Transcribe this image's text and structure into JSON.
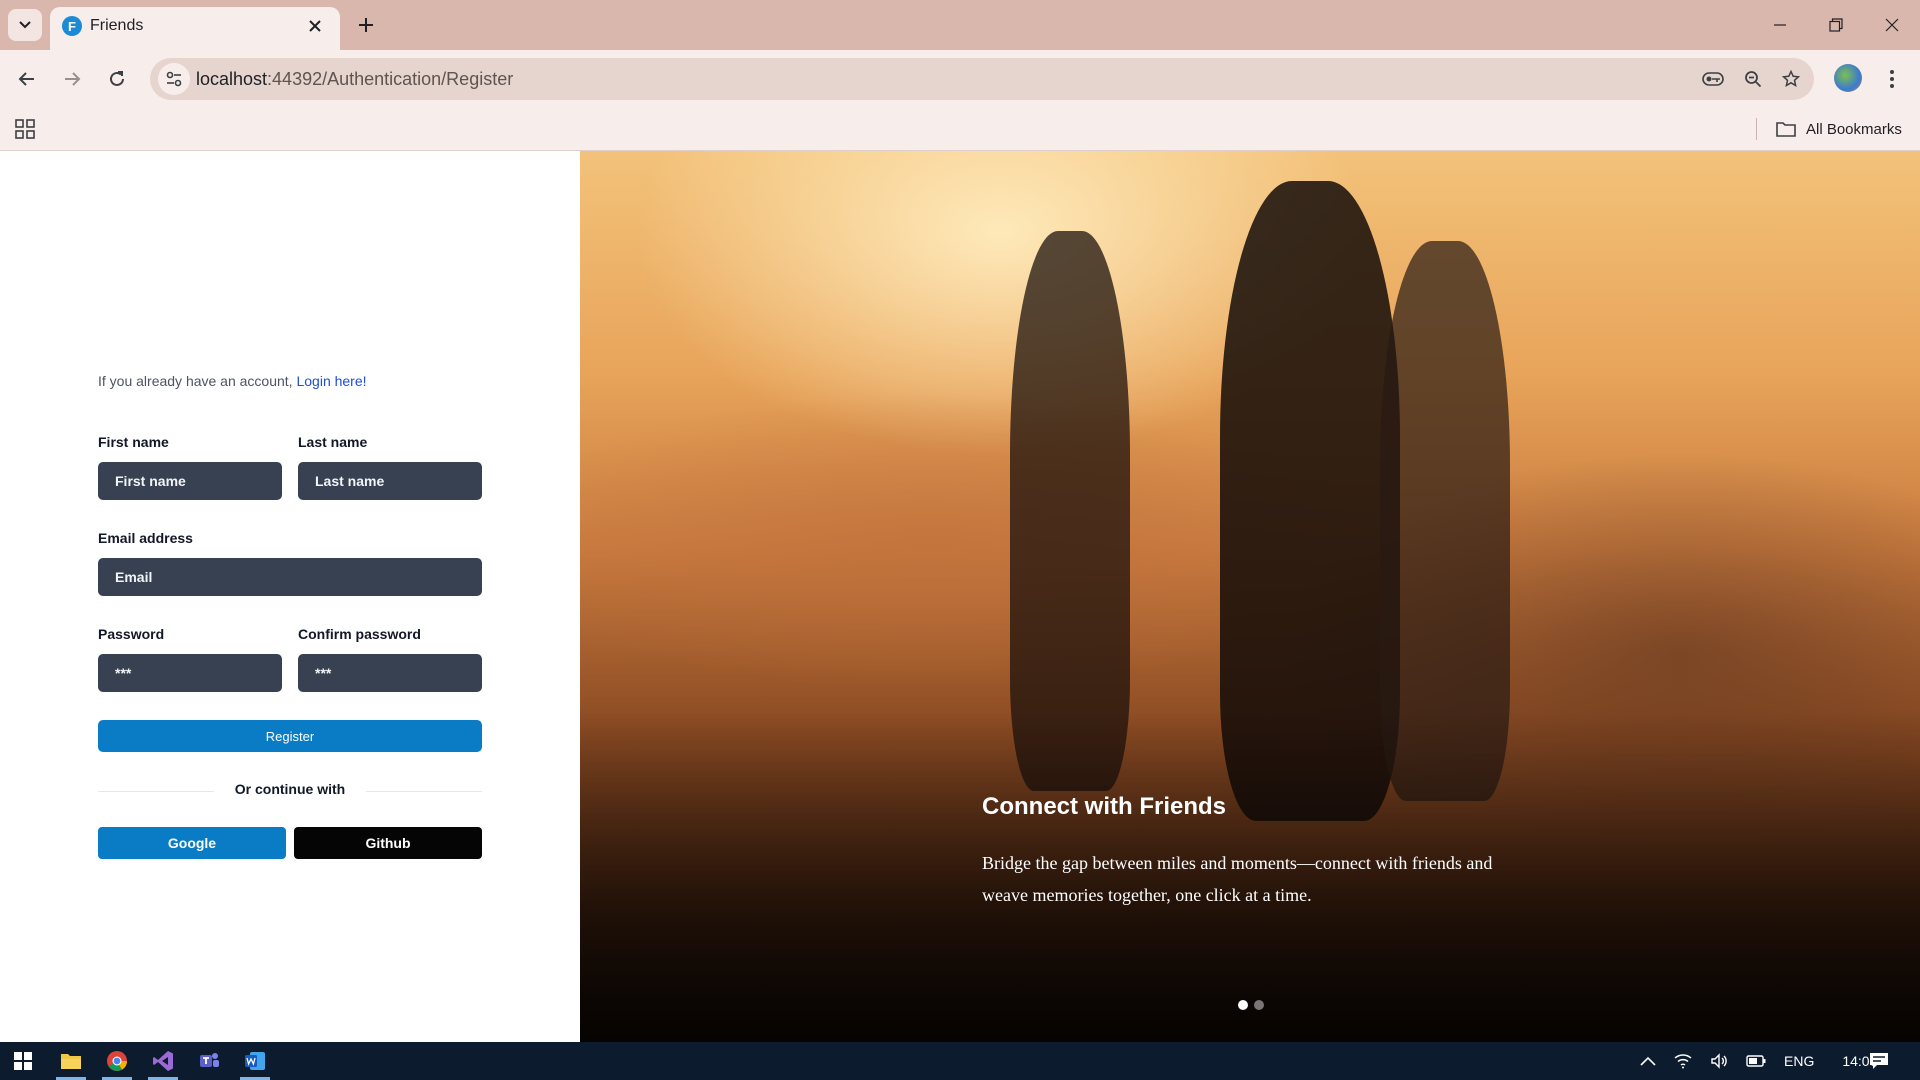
{
  "browser": {
    "tab_title": "Friends",
    "tab_favicon_letter": "F",
    "url_host": "localhost",
    "url_path": ":44392/Authentication/Register",
    "bookmarks_label": "All Bookmarks"
  },
  "form": {
    "account_prefix": "If you already have an account, ",
    "login_link": "Login here!",
    "first_name_label": "First name",
    "first_name_placeholder": "First name",
    "last_name_label": "Last name",
    "last_name_placeholder": "Last name",
    "email_label": "Email address",
    "email_placeholder": "Email",
    "password_label": "Password",
    "password_placeholder": "***",
    "confirm_label": "Confirm password",
    "confirm_placeholder": "***",
    "register_button": "Register",
    "divider_text": "Or continue with",
    "google_button": "Google",
    "github_button": "Github"
  },
  "hero": {
    "title": "Connect with Friends",
    "text": "Bridge the gap between miles and moments—connect with friends and weave memories together, one click at a time.",
    "slide_count": 2,
    "active_slide": 1
  },
  "taskbar": {
    "apps": [
      "windows-start",
      "file-explorer",
      "chrome",
      "visual-studio",
      "teams",
      "word"
    ],
    "language": "ENG",
    "time": "14:06"
  },
  "colors": {
    "accent": "#0a7cc6",
    "input_bg": "#374151",
    "tab_strip": "#d9b7ad"
  }
}
